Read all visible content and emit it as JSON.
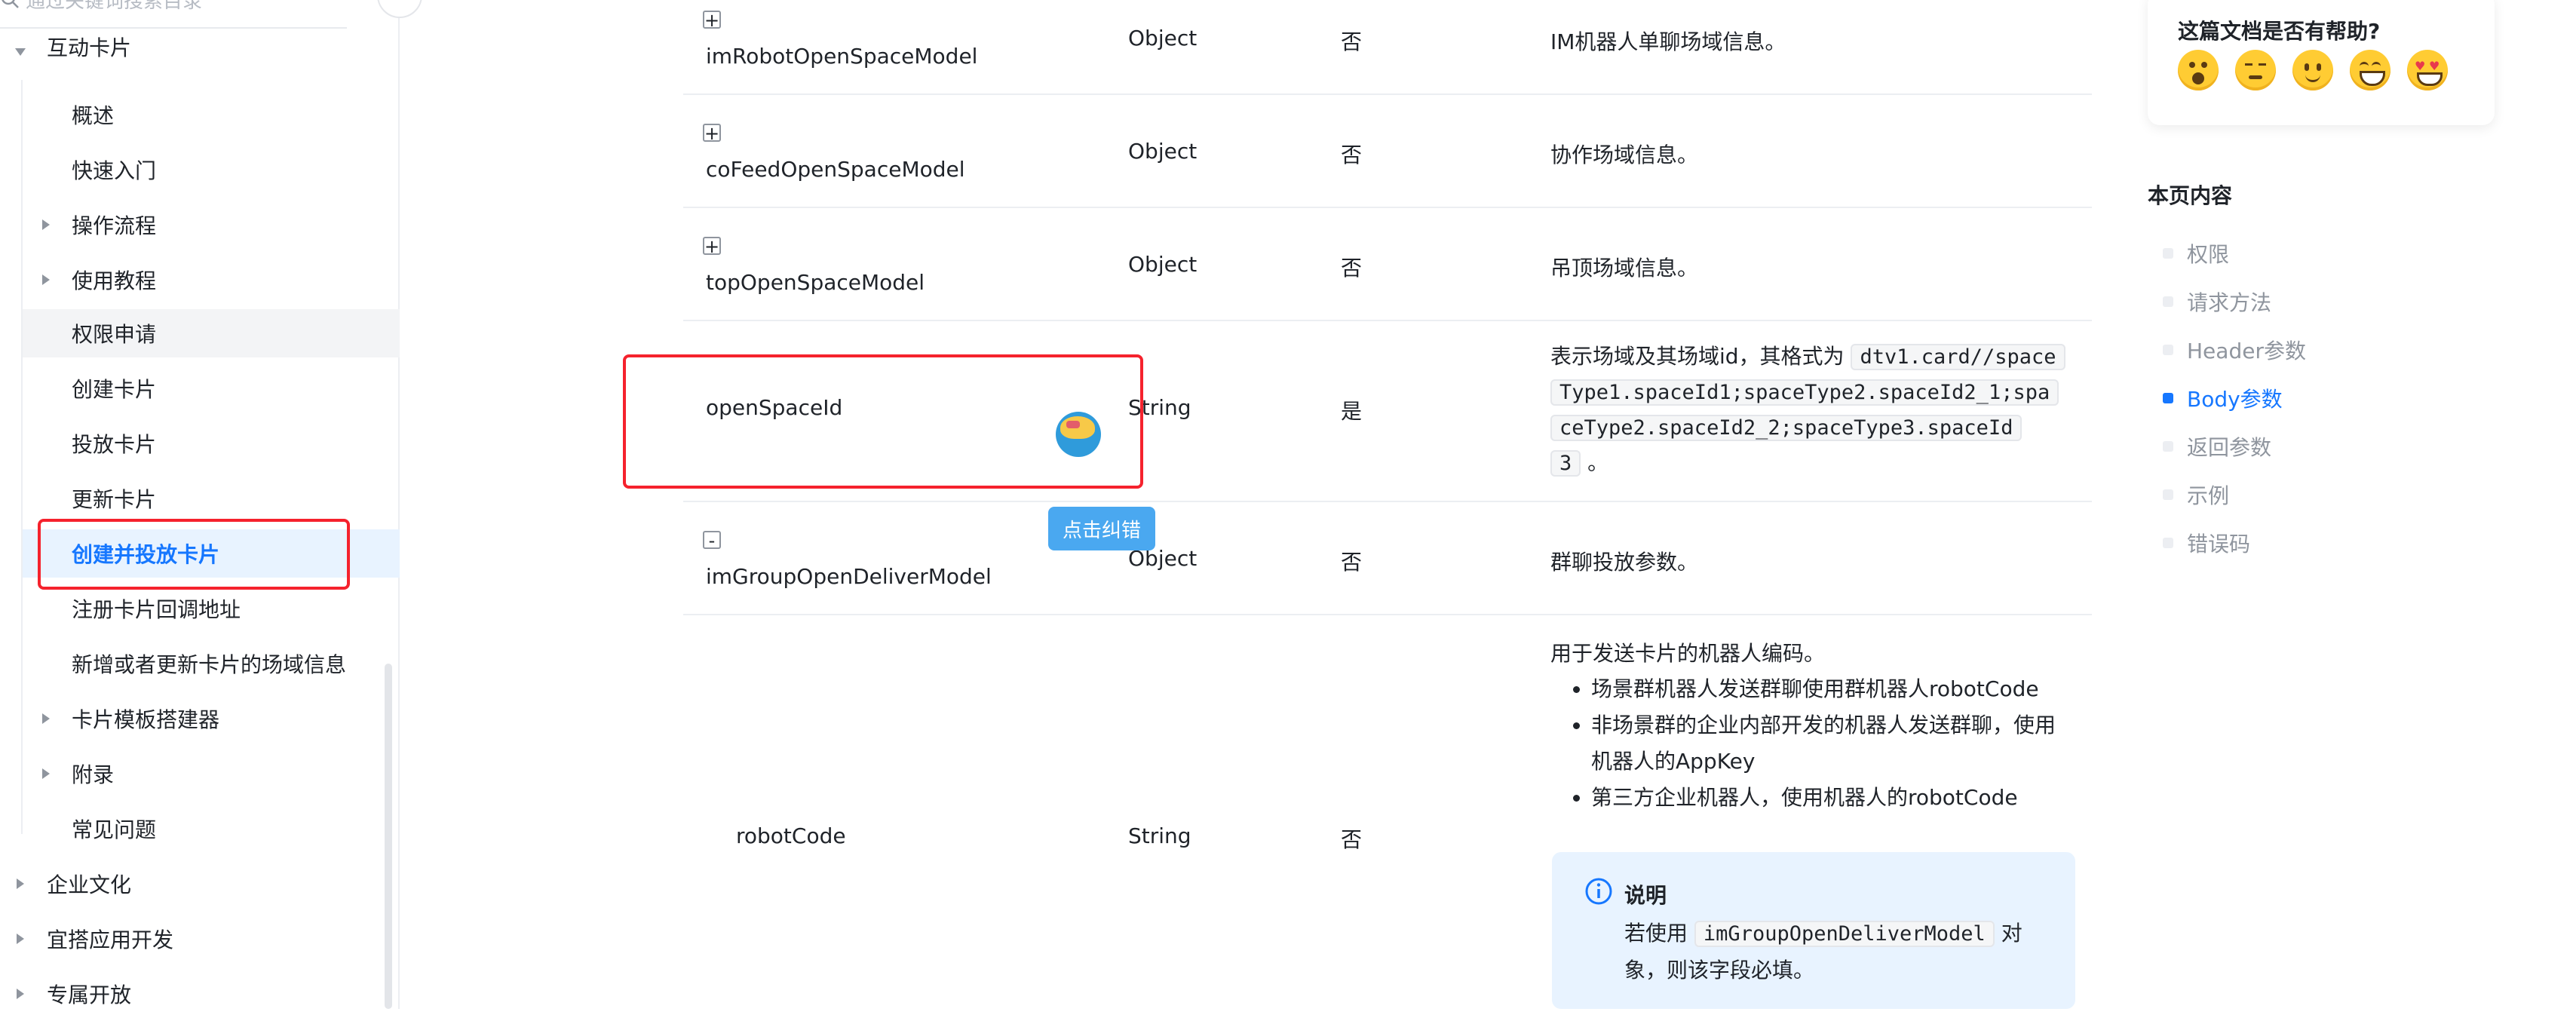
{
  "sidebar": {
    "search_placeholder": "通过关键词搜索目录",
    "section_label": "互动卡片",
    "items": [
      {
        "label": "概述"
      },
      {
        "label": "快速入门"
      },
      {
        "label": "操作流程"
      },
      {
        "label": "使用教程"
      },
      {
        "label": "权限申请"
      },
      {
        "label": "创建卡片"
      },
      {
        "label": "投放卡片"
      },
      {
        "label": "更新卡片"
      },
      {
        "label": "创建并投放卡片"
      },
      {
        "label": "注册卡片回调地址"
      },
      {
        "label": "新增或者更新卡片的场域信息"
      },
      {
        "label": "卡片模板搭建器"
      },
      {
        "label": "附录"
      },
      {
        "label": "常见问题"
      }
    ],
    "top_items": [
      {
        "label": "企业文化"
      },
      {
        "label": "宜搭应用开发"
      },
      {
        "label": "专属开放"
      }
    ]
  },
  "table": {
    "rows": [
      {
        "name": "imRobotOpenSpaceModel",
        "toggle": "+",
        "type": "Object",
        "required": "否",
        "desc": "IM机器人单聊场域信息。"
      },
      {
        "name": "coFeedOpenSpaceModel",
        "toggle": "+",
        "type": "Object",
        "required": "否",
        "desc": "协作场域信息。"
      },
      {
        "name": "topOpenSpaceModel",
        "toggle": "+",
        "type": "Object",
        "required": "否",
        "desc": "吊顶场域信息。"
      },
      {
        "name": "openSpaceId",
        "type": "String",
        "required": "是",
        "desc_prefix": "表示场域及其场域id，其格式为",
        "desc_code_1": "dtv1.card//space",
        "desc_code_2": "Type1.spaceId1;spaceType2.spaceId2_1;spa",
        "desc_code_3": "ceType2.spaceId2_2;spaceType3.spaceId",
        "desc_code_4": "3",
        "desc_suffix": "。"
      },
      {
        "name": "imGroupOpenDeliverModel",
        "toggle": "-",
        "type": "Object",
        "required": "否",
        "desc": "群聊投放参数。"
      },
      {
        "name": "robotCode",
        "type": "String",
        "required": "否",
        "desc_intro": "用于发送卡片的机器人编码。",
        "bullets": [
          "场景群机器人发送群聊使用群机器人robotCode",
          "非场景群的企业内部开发的机器人发送群聊，使用",
          "机器人的AppKey",
          "第三方企业机器人，使用机器人的robotCode"
        ],
        "note_title": "说明",
        "note_prefix": "若使用",
        "note_code": "imGroupOpenDeliverModel",
        "note_suffix_1": "对",
        "note_suffix_2": "象，则该字段必填。"
      }
    ]
  },
  "error_button": "点击纠错",
  "feedback": {
    "title": "这篇文档是否有帮助?",
    "emojis": [
      "very-bad-emoji",
      "bad-emoji",
      "neutral-emoji",
      "good-emoji",
      "love-emoji"
    ]
  },
  "toc": {
    "title": "本页内容",
    "items": [
      {
        "label": "权限"
      },
      {
        "label": "请求方法"
      },
      {
        "label": "Header参数"
      },
      {
        "label": "Body参数",
        "active": true
      },
      {
        "label": "返回参数"
      },
      {
        "label": "示例"
      },
      {
        "label": "错误码"
      }
    ]
  },
  "colors": {
    "accent": "#1677ff",
    "highlight_red": "#f5222d",
    "note_bg": "#e8f3ff"
  }
}
